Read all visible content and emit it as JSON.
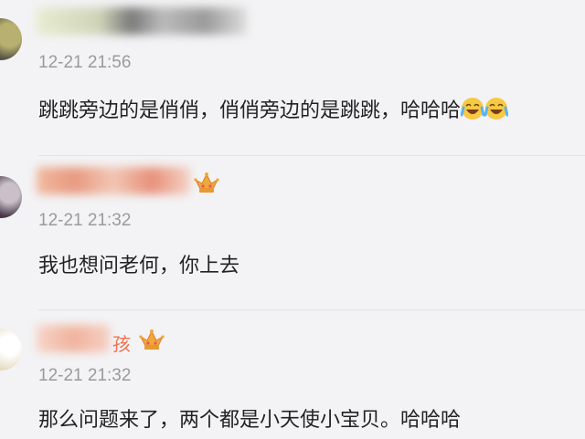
{
  "comments": [
    {
      "time": "12-21 21:56",
      "text": "跳跳旁边的是俏俏，俏俏旁边的是跳跳，哈哈哈",
      "emoji": "laughing-crying-emoji"
    },
    {
      "time": "12-21 21:32",
      "text": "我也想问老何，你上去",
      "badge": "crown-badge-icon"
    },
    {
      "name_visible": "孩",
      "time": "12-21 21:32",
      "text": "那么问题来了，两个都是小天使小宝贝。哈哈哈",
      "badge": "crown-badge-icon"
    }
  ],
  "colors": {
    "background": "#f3f3f5",
    "name": "#eb7350",
    "time": "#9a9a9a",
    "text": "#222222"
  }
}
